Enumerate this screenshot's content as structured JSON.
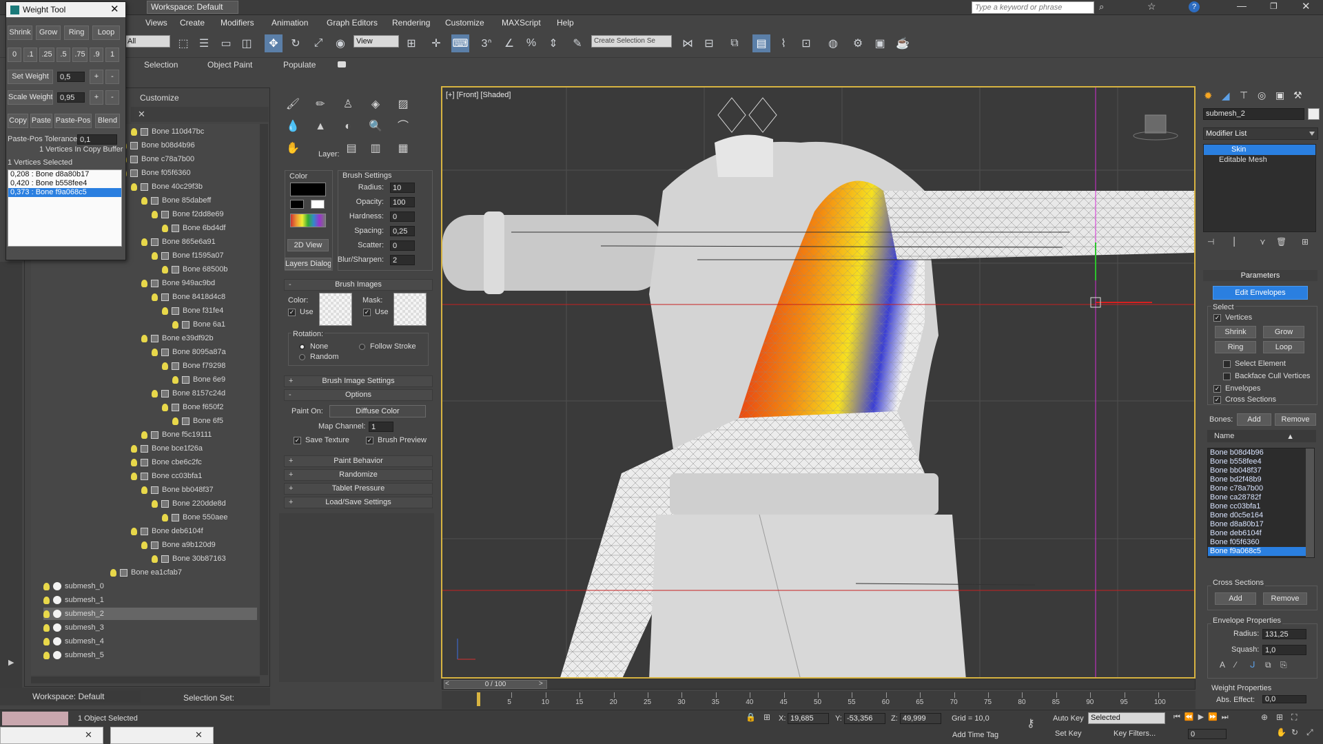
{
  "app": {
    "workspace_label": "Workspace: Default",
    "search_placeholder": "Type a keyword or phrase",
    "menu": [
      "Views",
      "Create",
      "Modifiers",
      "Animation",
      "Graph Editors",
      "Rendering",
      "Customize",
      "MAXScript",
      "Help"
    ]
  },
  "toolbar": {
    "filter_value": "All",
    "refcoord_value": "View",
    "selection_set_value": "Create Selection Se",
    "ribbon_tabs": [
      "Selection",
      "Object Paint",
      "Populate"
    ]
  },
  "weight_tool": {
    "title": "Weight Tool",
    "row1": [
      "Shrink",
      "Grow",
      "Ring",
      "Loop"
    ],
    "row2": [
      "0",
      ".1",
      ".25",
      ".5",
      ".75",
      ".9",
      "1"
    ],
    "set_weight_label": "Set Weight",
    "set_weight_value": "0,5",
    "scale_weight_label": "Scale Weight",
    "scale_weight_value": "0,95",
    "plus": "+",
    "minus": "-",
    "row5": [
      "Copy",
      "Paste",
      "Paste-Pos",
      "Blend"
    ],
    "tolerance_label": "Paste-Pos Tolerance",
    "tolerance_value": "0,1",
    "buffer_text": "1 Vertices In Copy Buffer",
    "selected_text": "1 Vertices Selected",
    "weights": [
      "0,208 : Bone d8a80b17",
      "0,420 : Bone b558fee4",
      "0,373 : Bone f9a068c5"
    ]
  },
  "scene_explorer": {
    "header": "Customize",
    "rows": [
      {
        "label": "Bone 110d47bc",
        "indent": 190
      },
      {
        "label": "Bone b08d4b96",
        "indent": 175
      },
      {
        "label": "Bone c78a7b00",
        "indent": 175
      },
      {
        "label": "Bone f05f6360",
        "indent": 175
      },
      {
        "label": "Bone 40c29f3b",
        "indent": 190
      },
      {
        "label": "Bone 85dabeff",
        "indent": 205
      },
      {
        "label": "Bone f2dd8e69",
        "indent": 220
      },
      {
        "label": "Bone 6bd4df",
        "indent": 235
      },
      {
        "label": "Bone 865e6a91",
        "indent": 205
      },
      {
        "label": "Bone f1595a07",
        "indent": 220
      },
      {
        "label": "Bone 68500b",
        "indent": 235
      },
      {
        "label": "Bone 949ac9bd",
        "indent": 205
      },
      {
        "label": "Bone 8418d4c8",
        "indent": 220
      },
      {
        "label": "Bone f31fe4",
        "indent": 235
      },
      {
        "label": "Bone 6a1",
        "indent": 250
      },
      {
        "label": "Bone e39df92b",
        "indent": 205
      },
      {
        "label": "Bone 8095a87a",
        "indent": 220
      },
      {
        "label": "Bone f79298",
        "indent": 235
      },
      {
        "label": "Bone 6e9",
        "indent": 250
      },
      {
        "label": "Bone 8157c24d",
        "indent": 220
      },
      {
        "label": "Bone f650f2",
        "indent": 235
      },
      {
        "label": "Bone 6f5",
        "indent": 250
      },
      {
        "label": "Bone f5c19111",
        "indent": 205
      },
      {
        "label": "Bone bce1f26a",
        "indent": 190
      },
      {
        "label": "Bone cbe6c2fc",
        "indent": 190
      },
      {
        "label": "Bone cc03bfa1",
        "indent": 190
      },
      {
        "label": "Bone bb048f37",
        "indent": 205
      },
      {
        "label": "Bone 220dde8d",
        "indent": 220
      },
      {
        "label": "Bone 550aee",
        "indent": 235
      },
      {
        "label": "Bone deb6104f",
        "indent": 190
      },
      {
        "label": "Bone a9b120d9",
        "indent": 205
      },
      {
        "label": "Bone 30b87163",
        "indent": 220
      },
      {
        "label": "Bone ea1cfab7",
        "indent": 160
      }
    ],
    "meshes": [
      "submesh_0",
      "submesh_1",
      "submesh_2",
      "submesh_3",
      "submesh_4",
      "submesh_5"
    ],
    "selected_mesh": "submesh_2",
    "workspace_bottom": "Workspace: Default",
    "selection_set_label": "Selection Set:"
  },
  "paint_panel": {
    "layer_label": "Layer:",
    "color_label": "Color",
    "brush_settings_label": "Brush Settings",
    "view2d": "2D View",
    "layers_dialog": "Layers Dialog",
    "settings": [
      {
        "label": "Radius:",
        "value": "10"
      },
      {
        "label": "Opacity:",
        "value": "100"
      },
      {
        "label": "Hardness:",
        "value": "0"
      },
      {
        "label": "Spacing:",
        "value": "0,25"
      },
      {
        "label": "Scatter:",
        "value": "0"
      },
      {
        "label": "Blur/Sharpen:",
        "value": "2"
      }
    ],
    "brush_images": "Brush Images",
    "color2": "Color:",
    "mask": "Mask:",
    "use": "Use",
    "rotation": "Rotation:",
    "rot_none": "None",
    "rot_follow": "Follow Stroke",
    "rot_random": "Random",
    "brush_image_settings": "Brush Image Settings",
    "options": "Options",
    "paint_on_label": "Paint On:",
    "paint_on_value": "Diffuse Color",
    "map_channel_label": "Map Channel:",
    "map_channel_value": "1",
    "save_texture": "Save Texture",
    "brush_preview": "Brush Preview",
    "rollouts": [
      "Paint Behavior",
      "Randomize",
      "Tablet Pressure",
      "Load/Save Settings"
    ]
  },
  "viewport": {
    "label": "[+] [Front] [Shaded]",
    "frame": "0 / 100",
    "ticks": [
      "5",
      "10",
      "15",
      "20",
      "25",
      "30",
      "35",
      "40",
      "45",
      "50",
      "55",
      "60",
      "65",
      "70",
      "75",
      "80",
      "85",
      "90",
      "95",
      "100"
    ]
  },
  "command_panel": {
    "object_name": "submesh_2",
    "modifier_list": "Modifier List",
    "stack": [
      "Skin",
      "Editable Mesh"
    ],
    "parameters": "Parameters",
    "edit_envelopes": "Edit Envelopes",
    "select": "Select",
    "vertices": "Vertices",
    "shrink": "Shrink",
    "grow": "Grow",
    "ring": "Ring",
    "loop": "Loop",
    "select_element": "Select Element",
    "backface": "Backface Cull Vertices",
    "envelopes": "Envelopes",
    "cross_sections": "Cross Sections",
    "bones_label": "Bones:",
    "add": "Add",
    "remove": "Remove",
    "name_col": "Name",
    "bones": [
      "Bone b08d4b96",
      "Bone b558fee4",
      "Bone bb048f37",
      "Bone bd2f48b9",
      "Bone c78a7b00",
      "Bone ca28782f",
      "Bone cc03bfa1",
      "Bone d0c5e164",
      "Bone d8a80b17",
      "Bone deb6104f",
      "Bone f05f6360",
      "Bone f9a068c5"
    ],
    "selected_bone": "Bone f9a068c5",
    "cross_sections_group": "Cross Sections",
    "envelope_props": "Envelope Properties",
    "radius_label": "Radius:",
    "radius_value": "131,25",
    "squash_label": "Squash:",
    "squash_value": "1,0",
    "weight_props": "Weight Properties",
    "abs_effect_label": "Abs. Effect:",
    "abs_effect_value": "0,0"
  },
  "status": {
    "selected": "1 Object Selected",
    "x_label": "X:",
    "x_value": "19,685",
    "y_label": "Y:",
    "y_value": "-53,356",
    "z_label": "Z:",
    "z_value": "49,999",
    "grid": "Grid = 10,0",
    "add_time_tag": "Add Time Tag",
    "auto_key": "Auto Key",
    "set_key": "Set Key",
    "key_mode": "Selected",
    "key_filters": "Key Filters...",
    "frame_value": "0"
  }
}
